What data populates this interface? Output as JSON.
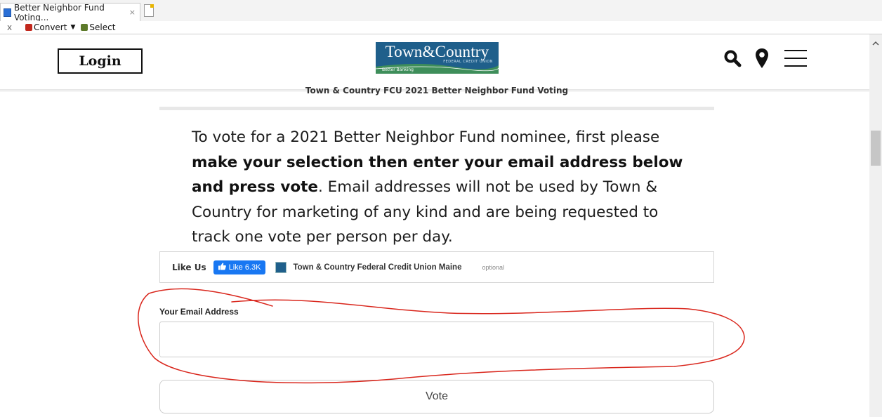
{
  "browser": {
    "tab_title": "Better Neighbor Fund Voting...",
    "tab_close": "×",
    "toolbar": {
      "close_label": "x",
      "convert_label": "Convert",
      "convert_caret": "▼",
      "select_label": "Select"
    }
  },
  "header": {
    "login_label": "Login",
    "logo_text": "Town&Country",
    "logo_subtext": "FEDERAL CREDIT UNION",
    "logo_tagline": "Better Banking",
    "icons": [
      "search-icon",
      "location-pin-icon",
      "menu-icon"
    ]
  },
  "form": {
    "title": "Town & Country FCU 2021 Better Neighbor Fund Voting",
    "intro_part1": "To vote for a 2021 Better Neighbor Fund nominee, first please ",
    "intro_bold": "make your selection then enter your email address below and press vote",
    "intro_part2": ". Email addresses will not be used by Town & Country for marketing of any kind and are being requested to track one vote per person per day.",
    "like": {
      "label": "Like Us",
      "button_label": "Like",
      "count": "6.3K",
      "page_name": "Town & Country Federal Credit Union Maine",
      "optional": "optional"
    },
    "email_label": "Your Email Address",
    "email_value": "",
    "email_placeholder": "",
    "vote_label": "Vote"
  },
  "colors": {
    "annotation": "#d9261c",
    "facebook": "#1877f2",
    "logo_blue": "#1f5f8b",
    "logo_green": "#3e8e5a"
  }
}
